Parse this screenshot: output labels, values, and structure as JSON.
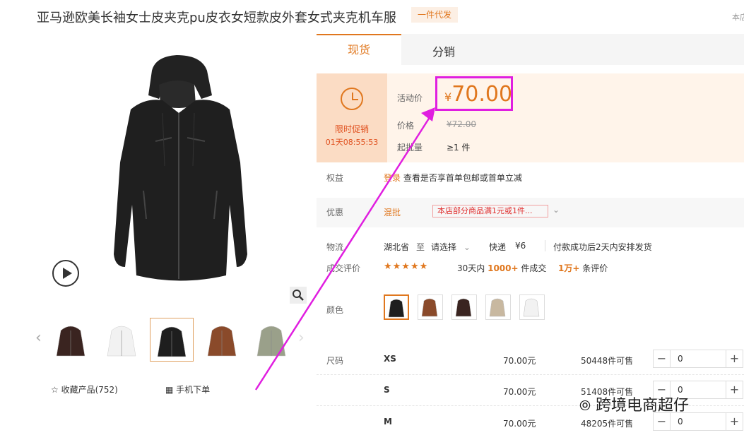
{
  "header": {
    "title": "亚马逊欧美长袖女士皮夹克pu皮衣女短款皮外套女式夹克机车服",
    "badge": "一件代发",
    "top_right_text": "本店"
  },
  "gallery": {
    "favorites_label": "收藏产品(752)",
    "mobile_order_label": "手机下单",
    "thumbnail_colors": [
      "#3a2420",
      "#f2f2f2",
      "#1e1e1e",
      "#8a4a2a",
      "#9aa08a"
    ],
    "selected_thumbnail": 2
  },
  "tabs": [
    {
      "label": "现货",
      "active": true
    },
    {
      "label": "分销",
      "active": false
    }
  ],
  "promotion": {
    "title": "限时促销",
    "countdown": "01天08:55:53"
  },
  "pricing": {
    "activity_price_label": "活动价",
    "currency_symbol": "¥",
    "activity_price": "70.00",
    "price_label": "价格",
    "original_price": "¥72.00",
    "min_order_label": "起批量",
    "min_order_value": "≥1 件"
  },
  "benefits": {
    "label": "权益",
    "login_link": "登录",
    "text": "查看是否享首单包邮或首单立减"
  },
  "discount": {
    "label": "优惠",
    "type": "混批",
    "coupon": "本店部分商品满1元或1件..."
  },
  "logistics": {
    "label": "物流",
    "origin": "湖北省",
    "to": "至",
    "destination": "请选择",
    "method": "快递",
    "fee": "¥6",
    "note": "付款成功后2天内安排发货"
  },
  "reviews": {
    "label": "成交评价",
    "stars": "★★★★★",
    "period": "30天内",
    "deals_count": "1000+",
    "deals_suffix": "件成交",
    "review_count": "1万+",
    "review_suffix": "条评价"
  },
  "colors": {
    "label": "颜色",
    "swatches": [
      "#1e1e1e",
      "#8a4a2a",
      "#3a2420",
      "#c8b8a0",
      "#f2f2f2"
    ],
    "selected": 0
  },
  "sizes": {
    "label": "尺码",
    "rows": [
      {
        "size": "XS",
        "price": "70.00元",
        "stock": "50448件可售",
        "qty": "0"
      },
      {
        "size": "S",
        "price": "70.00元",
        "stock": "51408件可售",
        "qty": "0"
      },
      {
        "size": "M",
        "price": "70.00元",
        "stock": "48205件可售",
        "qty": "0"
      }
    ]
  },
  "watermark": "跨境电商超仔",
  "colors_theme": {
    "accent": "#e0771e",
    "highlight": "#e01ee0"
  }
}
